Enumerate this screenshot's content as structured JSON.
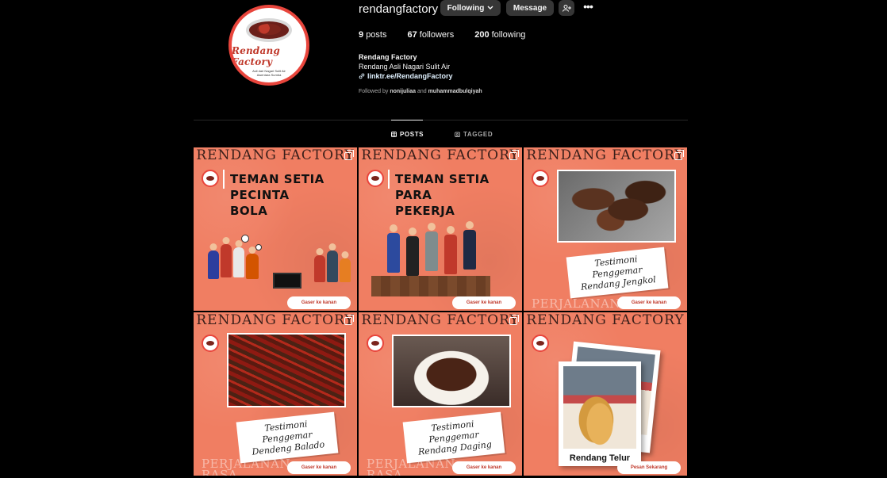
{
  "profile": {
    "username": "rendangfactory",
    "following_btn": "Following",
    "message_btn": "Message",
    "avatar_title": "Rendang Factory",
    "avatar_sub": "Asli dari Nagari Sulit Air Awentara Sumba"
  },
  "stats": {
    "posts_count": "9",
    "posts_label": "posts",
    "followers_count": "67",
    "followers_label": "followers",
    "following_count": "200",
    "following_label": "following"
  },
  "bio": {
    "name": "Rendang Factory",
    "line": "Rendang Asli Nagari Sulit Air",
    "link": "linktr.ee/RendangFactory"
  },
  "followed_by": {
    "prefix": "Followed by",
    "user1": "nonijuliaa",
    "and": "and",
    "user2": "muhammadbulqiyah"
  },
  "tabs": {
    "posts": "POSTS",
    "tagged": "TAGGED"
  },
  "posts": [
    {
      "brand": "RENDANG FACTORY",
      "title": "TEMAN SETIA\nPECINTA\nBOLA",
      "cta": "Gaser ke kanan"
    },
    {
      "brand": "RENDANG FACTORY",
      "title": "TEMAN SETIA\nPARA\nPEKERJA",
      "cta": "Gaser ke kanan"
    },
    {
      "brand": "RENDANG FACTORY",
      "testimonial": "Testimoni Penggemar Rendang Jengkol",
      "journey": "PERJALANAN",
      "cta": "Gaser ke kanan"
    },
    {
      "brand": "RENDANG FACTORY",
      "testimonial": "Testimoni Penggemar Dendeng Balado",
      "journey": "PERJALANAN RASA",
      "cta": "Gaser ke kanan"
    },
    {
      "brand": "RENDANG FACTORY",
      "testimonial": "Testimoni Penggemar Rendang Daging",
      "journey": "PERJALANAN RASA",
      "cta": "Gaser ke kanan"
    },
    {
      "brand": "RENDANG FACTORY",
      "caption": "Rendang Telur",
      "cta": "Pesan Sekarang"
    }
  ]
}
